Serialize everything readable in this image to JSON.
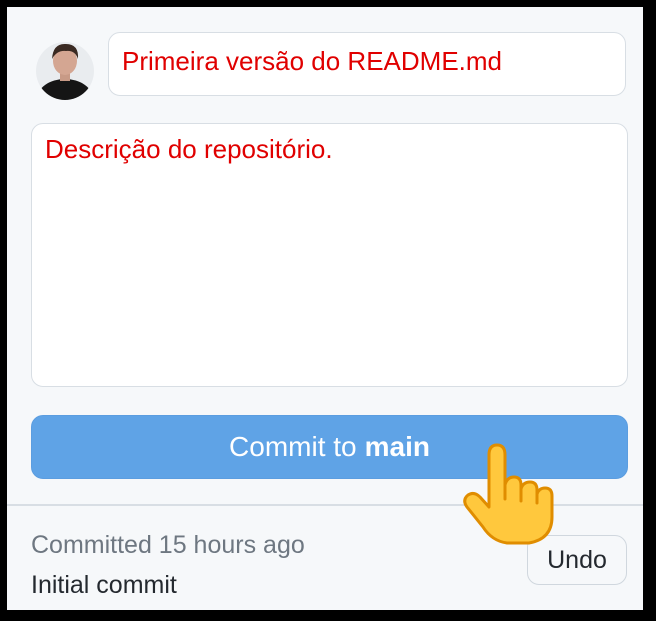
{
  "commit_form": {
    "summary_value": "Primeira versão do README.md",
    "description_value": "Descrição do repositório.",
    "commit_button": {
      "prefix": "Commit to",
      "branch": "main"
    }
  },
  "last_commit": {
    "status": "Committed 15 hours ago",
    "message": "Initial commit",
    "undo_label": "Undo"
  },
  "icons": {
    "avatar": "user-avatar",
    "pointer": "pointing-hand-icon"
  },
  "colors": {
    "input_text": "#e00000",
    "commit_button_bg": "#5fa3e6",
    "panel_bg": "#f6f8fa"
  }
}
